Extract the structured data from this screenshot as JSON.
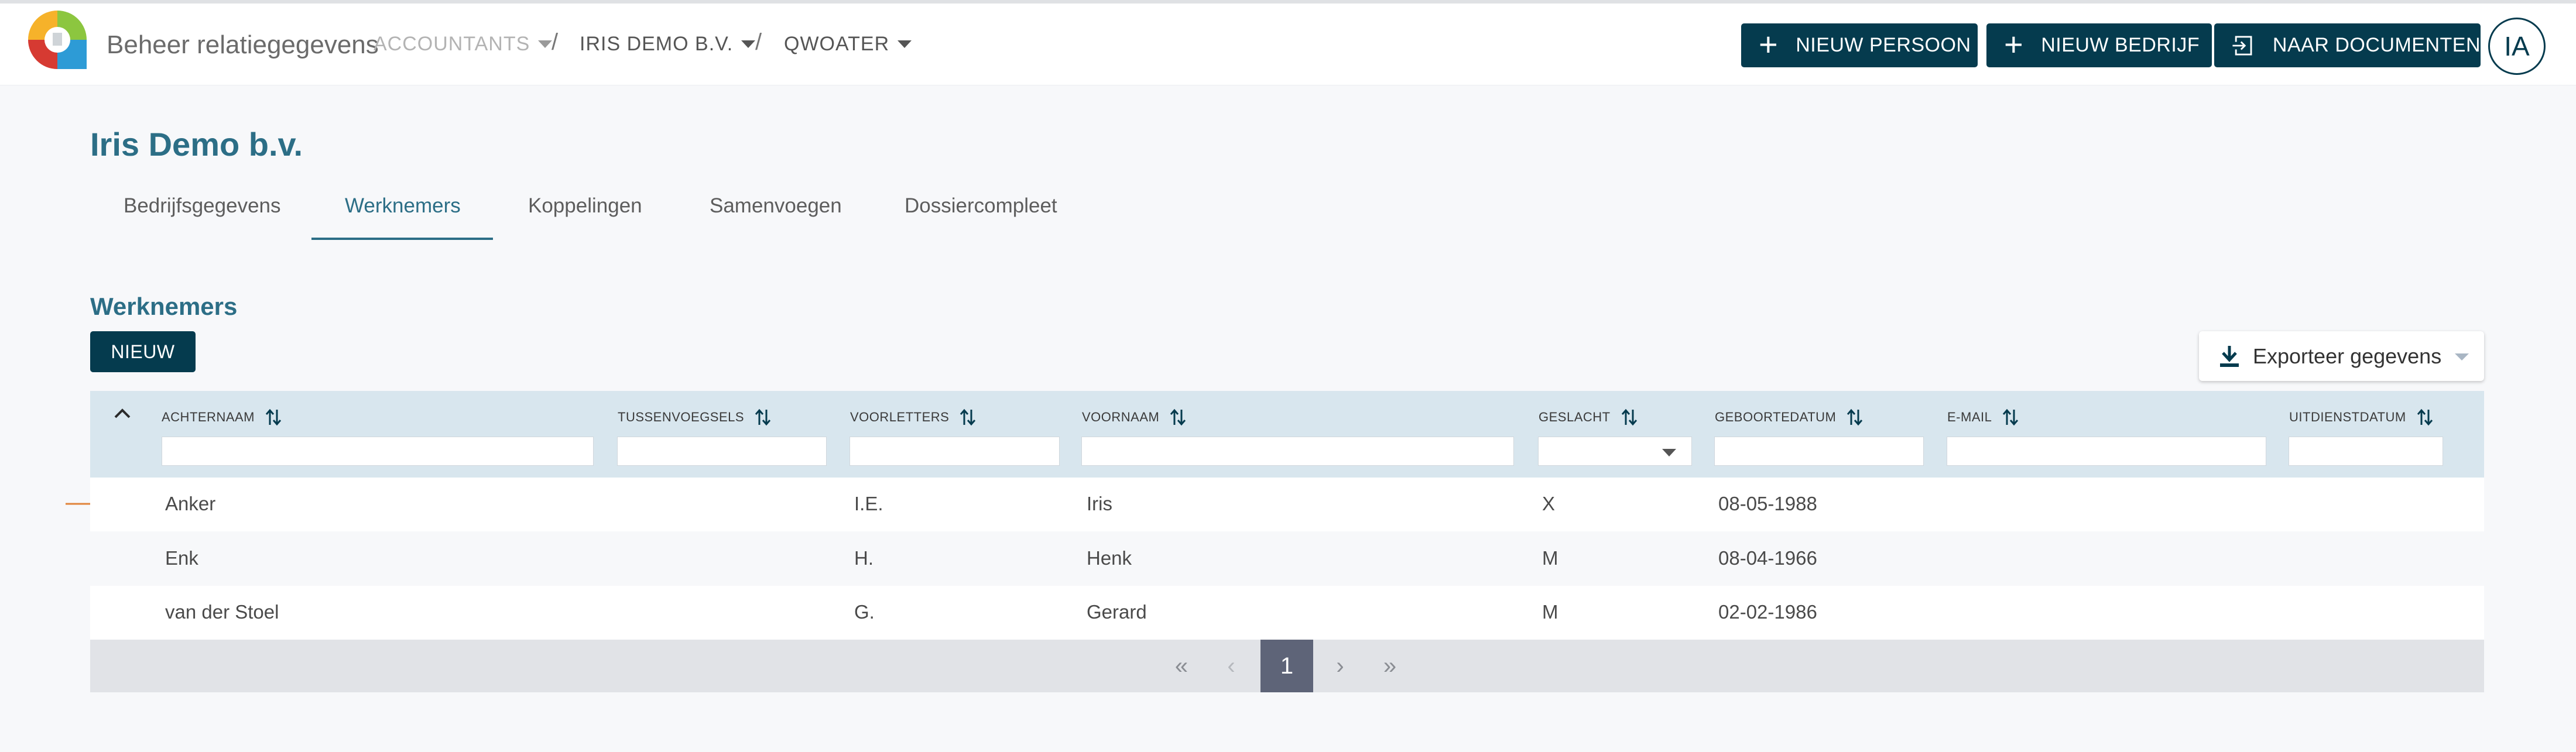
{
  "header": {
    "app_title": "Beheer relatiegegevens",
    "breadcrumbs": [
      "ACCOUNTANTS",
      "IRIS DEMO B.V.",
      "QWOATER"
    ],
    "separator": "/",
    "buttons": {
      "new_person": "NIEUW PERSOON",
      "new_company": "NIEUW BEDRIJF",
      "to_documents": "NAAR DOCUMENTEN"
    },
    "avatar_initials": "IA"
  },
  "company_name": "Iris Demo b.v.",
  "tabs": [
    "Bedrijfsgegevens",
    "Werknemers",
    "Koppelingen",
    "Samenvoegen",
    "Dossiercompleet"
  ],
  "active_tab": "Werknemers",
  "section": {
    "title": "Werknemers",
    "new_button": "NIEUW",
    "export_button": "Exporteer gegevens"
  },
  "table": {
    "columns": [
      "ACHTERNAAM",
      "TUSSENVOEGSELS",
      "VOORLETTERS",
      "VOORNAAM",
      "GESLACHT",
      "GEBOORTEDATUM",
      "E-MAIL",
      "UITDIENSTDATUM"
    ],
    "rows": [
      {
        "achternaam": "Anker",
        "tussenvoegsels": "",
        "voorletters": "I.E.",
        "voornaam": "Iris",
        "geslacht": "X",
        "geboortedatum": "08-05-1988",
        "email": "",
        "uitdienstdatum": ""
      },
      {
        "achternaam": "Enk",
        "tussenvoegsels": "",
        "voorletters": "H.",
        "voornaam": "Henk",
        "geslacht": "M",
        "geboortedatum": "08-04-1966",
        "email": "",
        "uitdienstdatum": ""
      },
      {
        "achternaam": "van der Stoel",
        "tussenvoegsels": "",
        "voorletters": "G.",
        "voornaam": "Gerard",
        "geslacht": "M",
        "geboortedatum": "02-02-1986",
        "email": "",
        "uitdienstdatum": ""
      }
    ]
  },
  "pagination": {
    "first": "«",
    "prev": "‹",
    "current_page": "1",
    "next": "›",
    "last": "»"
  },
  "colors": {
    "primary_dark": "#053b4e",
    "accent_teal": "#2c6e86",
    "table_header": "#d8e6ee",
    "pager_active": "#5e6478",
    "arrow_orange": "#e0843a"
  }
}
